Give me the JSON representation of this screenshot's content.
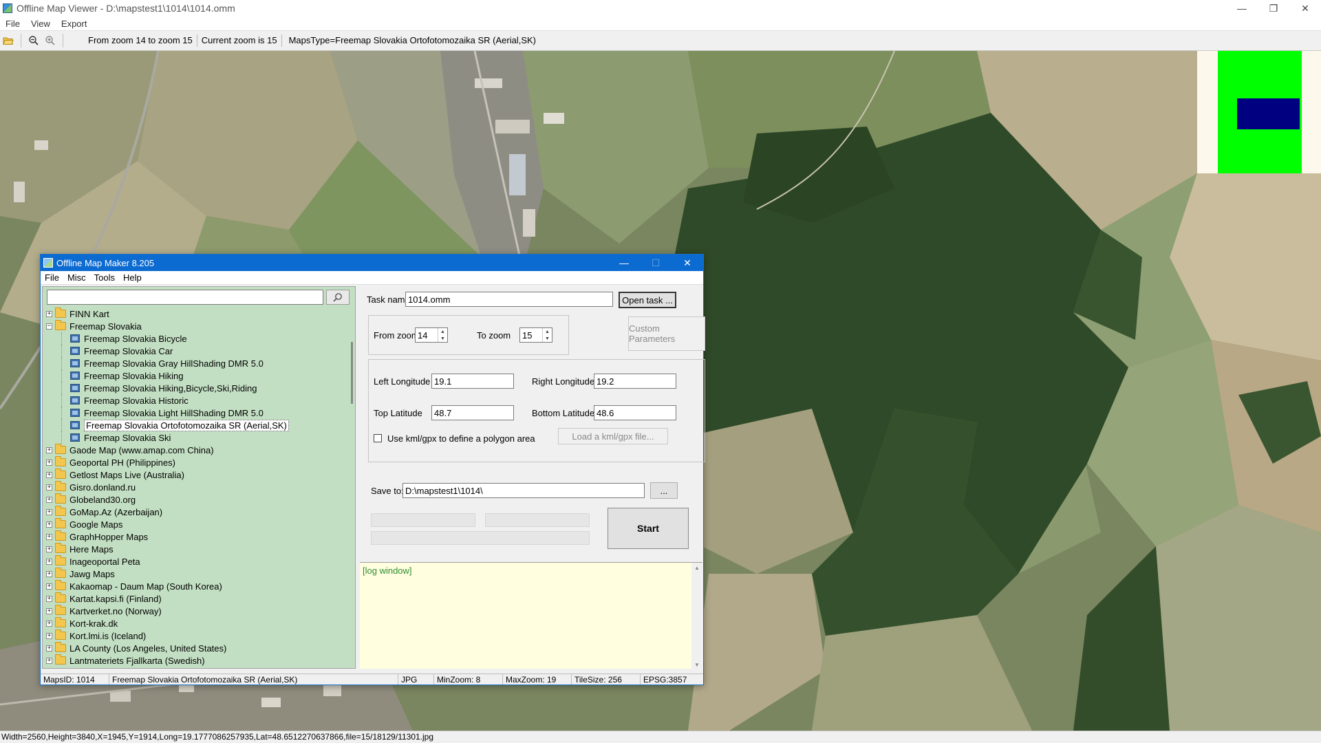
{
  "window": {
    "title": "Offline Map Viewer - D:\\mapstest1\\1014\\1014.omm",
    "menu": [
      "File",
      "View",
      "Export"
    ],
    "controls": {
      "minimize": "—",
      "restore": "❐",
      "close": "✕"
    }
  },
  "toolbar": {
    "icons": [
      "open-folder-icon",
      "zoom-out-icon",
      "zoom-in-icon"
    ],
    "zoom_range": "From zoom 14 to zoom 15",
    "current_zoom": "Current zoom is 15",
    "maps_type": "MapsType=Freemap Slovakia Ortofotomozaika SR (Aerial,SK)"
  },
  "minimap": {
    "frame_color": "#00ff00",
    "view_color": "#000080"
  },
  "statusbar": {
    "text": "Width=2560,Height=3840,X=1945,Y=1914,Long=19.1777086257935,Lat=48.6512270637866,file=15/18129/11301.jpg"
  },
  "dialog": {
    "title": "Offline Map Maker 8.205",
    "menu": [
      "File",
      "Misc",
      "Tools",
      "Help"
    ],
    "search": {
      "value": "",
      "placeholder": ""
    },
    "tree": [
      {
        "label": "FINN Kart",
        "expanded": false,
        "children": []
      },
      {
        "label": "Freemap Slovakia",
        "expanded": true,
        "children": [
          {
            "label": "Freemap Slovakia Bicycle",
            "selected": false
          },
          {
            "label": "Freemap Slovakia Car",
            "selected": false
          },
          {
            "label": "Freemap Slovakia Gray HillShading DMR 5.0",
            "selected": false
          },
          {
            "label": "Freemap Slovakia Hiking",
            "selected": false
          },
          {
            "label": "Freemap Slovakia Hiking,Bicycle,Ski,Riding",
            "selected": false
          },
          {
            "label": "Freemap Slovakia Historic",
            "selected": false
          },
          {
            "label": "Freemap Slovakia Light HillShading DMR 5.0",
            "selected": false
          },
          {
            "label": "Freemap Slovakia Ortofotomozaika SR (Aerial,SK)",
            "selected": true
          },
          {
            "label": "Freemap Slovakia Ski",
            "selected": false
          }
        ]
      },
      {
        "label": "Gaode Map (www.amap.com China)",
        "expanded": false,
        "children": []
      },
      {
        "label": "Geoportal PH (Philippines)",
        "expanded": false,
        "children": []
      },
      {
        "label": "Getlost Maps Live (Australia)",
        "expanded": false,
        "children": []
      },
      {
        "label": "Gisro.donland.ru",
        "expanded": false,
        "children": []
      },
      {
        "label": "Globeland30.org",
        "expanded": false,
        "children": []
      },
      {
        "label": "GoMap.Az (Azerbaijan)",
        "expanded": false,
        "children": []
      },
      {
        "label": "Google Maps",
        "expanded": false,
        "children": []
      },
      {
        "label": "GraphHopper Maps",
        "expanded": false,
        "children": []
      },
      {
        "label": "Here Maps",
        "expanded": false,
        "children": []
      },
      {
        "label": "Inageoportal Peta",
        "expanded": false,
        "children": []
      },
      {
        "label": "Jawg Maps",
        "expanded": false,
        "children": []
      },
      {
        "label": "Kakaomap - Daum Map (South Korea)",
        "expanded": false,
        "children": []
      },
      {
        "label": "Kartat.kapsi.fi (Finland)",
        "expanded": false,
        "children": []
      },
      {
        "label": "Kartverket.no (Norway)",
        "expanded": false,
        "children": []
      },
      {
        "label": "Kort-krak.dk",
        "expanded": false,
        "children": []
      },
      {
        "label": "Kort.lmi.is (Iceland)",
        "expanded": false,
        "children": []
      },
      {
        "label": "LA County (Los Angeles, United States)",
        "expanded": false,
        "children": []
      },
      {
        "label": "Lantmateriets Fjallkarta (Swedish)",
        "expanded": false,
        "children": []
      }
    ],
    "task": {
      "label": "Task name",
      "value": "1014.omm",
      "open_button": "Open task ..."
    },
    "zoom": {
      "from_label": "From zoom",
      "from_value": "14",
      "to_label": "To zoom",
      "to_value": "15"
    },
    "custom_params_button": "Custom Parameters",
    "coords": {
      "left_lon_label": "Left Longitude",
      "left_lon": "19.1",
      "right_lon_label": "Right Longitude",
      "right_lon": "19.2",
      "top_lat_label": "Top Latitude",
      "top_lat": "48.7",
      "bottom_lat_label": "Bottom Latitude",
      "bottom_lat": "48.6"
    },
    "kml": {
      "checkbox_label": "Use kml/gpx to define a polygon area",
      "checked": false,
      "load_button": "Load a kml/gpx file..."
    },
    "save": {
      "label": "Save to:",
      "value": "D:\\mapstest1\\1014\\",
      "browse_button": "..."
    },
    "start_button": "Start",
    "log_text": "[log window]",
    "status": {
      "maps_id": "MapsID: 1014",
      "map_name": "Freemap Slovakia Ortofotomozaika SR (Aerial,SK)",
      "format": "JPG",
      "min_zoom": "MinZoom: 8",
      "max_zoom": "MaxZoom: 19",
      "tile_size": "TileSize: 256",
      "epsg": "EPSG:3857"
    }
  }
}
